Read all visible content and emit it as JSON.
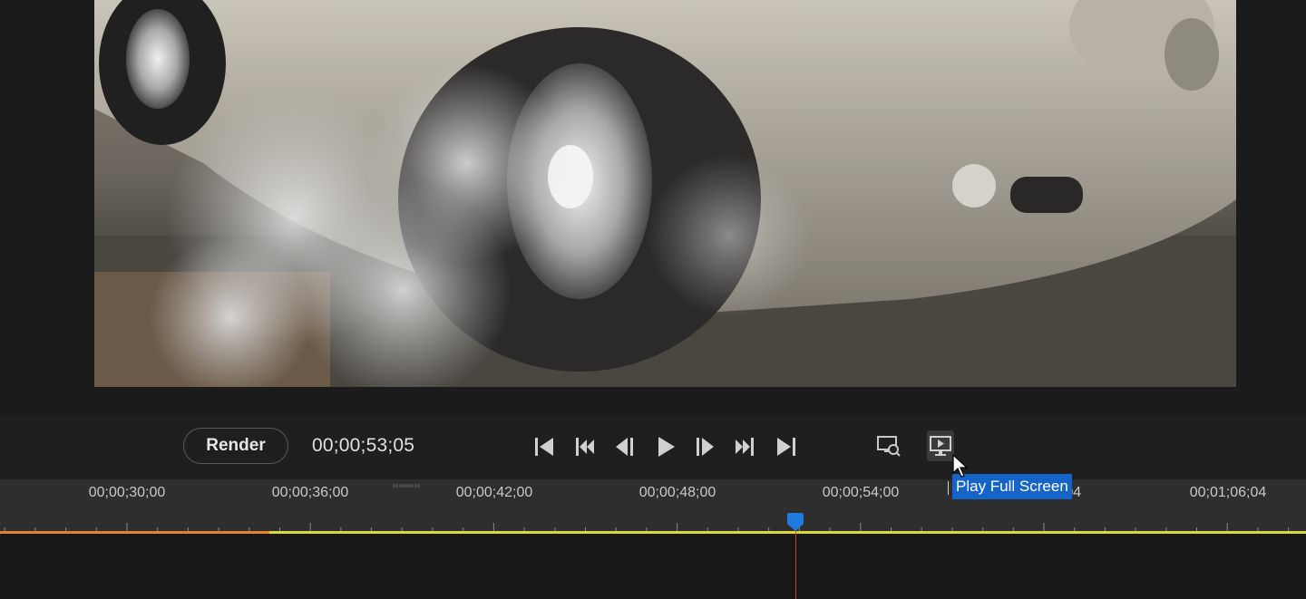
{
  "controls": {
    "render_label": "Render",
    "current_timecode": "00;00;53;05"
  },
  "transport": [
    {
      "name": "go-to-start",
      "icon": "skip-to-start-icon"
    },
    {
      "name": "previous-edit-point",
      "icon": "step-back-double-icon"
    },
    {
      "name": "previous-frame",
      "icon": "frame-back-icon"
    },
    {
      "name": "play",
      "icon": "play-icon"
    },
    {
      "name": "next-frame",
      "icon": "frame-forward-icon"
    },
    {
      "name": "next-edit-point",
      "icon": "step-forward-double-icon"
    },
    {
      "name": "go-to-end",
      "icon": "skip-to-end-icon"
    }
  ],
  "tools": [
    {
      "name": "zoom-preview",
      "icon": "monitor-zoom-icon"
    },
    {
      "name": "play-full-screen",
      "icon": "monitor-play-icon",
      "active": true
    }
  ],
  "tooltip": "Play Full Screen",
  "ruler": {
    "labels": [
      "00;00;30;00",
      "00;00;36;00",
      "00;00;42;00",
      "00;00;48;00",
      "00;00;54;00",
      "00;01;00;04",
      "00;01;06;04"
    ],
    "visible_partial": ";04"
  },
  "colors": {
    "accent": "#1565c8",
    "playhead": "#d23a3a",
    "workarea_rendered": "#e8822a",
    "workarea_unrendered": "#d8d83a"
  }
}
